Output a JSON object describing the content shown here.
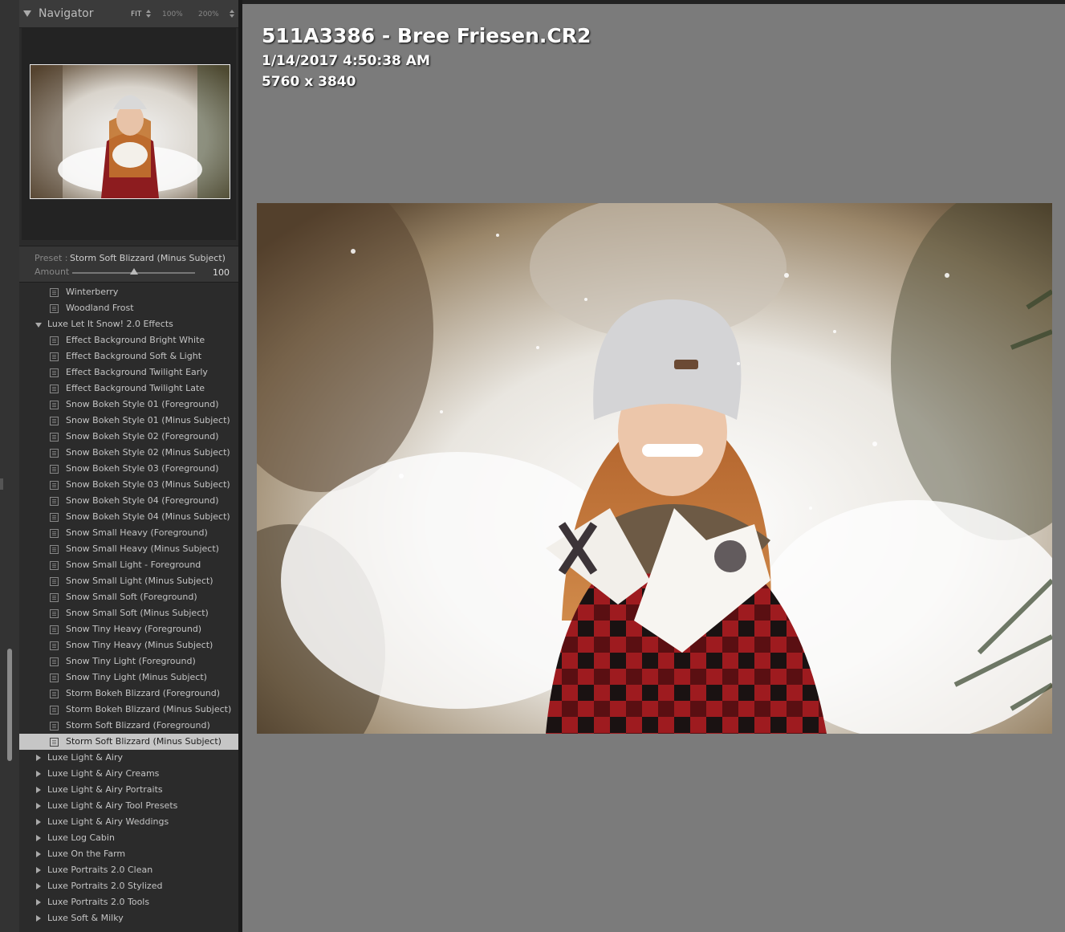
{
  "navigator": {
    "title": "Navigator",
    "zoom": {
      "fit": "FIT",
      "z100": "100%",
      "z200": "200%"
    }
  },
  "preset_panel": {
    "preset_label": "Preset :",
    "preset_value": "Storm Soft Blizzard (Minus Subject)",
    "amount_label": "Amount",
    "amount_value": "100"
  },
  "presets": {
    "items_before": [
      "Winterberry",
      "Woodland Frost"
    ],
    "expanded_folder": "Luxe Let It Snow! 2.0 Effects",
    "expanded_items": [
      "Effect Background Bright White",
      "Effect Background Soft & Light",
      "Effect Background Twilight Early",
      "Effect Background Twilight Late",
      "Snow Bokeh Style 01 (Foreground)",
      "Snow Bokeh Style 01 (Minus Subject)",
      "Snow Bokeh Style 02 (Foreground)",
      "Snow Bokeh Style 02 (Minus Subject)",
      "Snow Bokeh Style 03 (Foreground)",
      "Snow Bokeh Style 03 (Minus Subject)",
      "Snow Bokeh Style 04 (Foreground)",
      "Snow Bokeh Style 04 (Minus Subject)",
      "Snow Small Heavy (Foreground)",
      "Snow Small Heavy (Minus Subject)",
      "Snow Small Light - Foreground",
      "Snow Small Light (Minus Subject)",
      "Snow Small Soft (Foreground)",
      "Snow Small Soft (Minus Subject)",
      "Snow Tiny Heavy (Foreground)",
      "Snow Tiny Heavy (Minus Subject)",
      "Snow Tiny Light (Foreground)",
      "Snow Tiny Light (Minus Subject)",
      "Storm Bokeh Blizzard (Foreground)",
      "Storm Bokeh Blizzard (Minus Subject)",
      "Storm Soft Blizzard (Foreground)",
      "Storm Soft Blizzard (Minus Subject)"
    ],
    "selected": "Storm Soft Blizzard (Minus Subject)",
    "collapsed_folders": [
      "Luxe Light & Airy",
      "Luxe Light & Airy Creams",
      "Luxe Light & Airy Portraits",
      "Luxe Light & Airy Tool Presets",
      "Luxe Light & Airy Weddings",
      "Luxe Log Cabin",
      "Luxe On the Farm",
      "Luxe Portraits 2.0 Clean",
      "Luxe Portraits 2.0 Stylized",
      "Luxe Portraits 2.0 Tools",
      "Luxe Soft & Milky"
    ]
  },
  "photo_info": {
    "filename": "511A3386 - Bree Friesen.CR2",
    "datetime": "1/14/2017 4:50:38 AM",
    "dimensions": "5760 x 3840"
  }
}
